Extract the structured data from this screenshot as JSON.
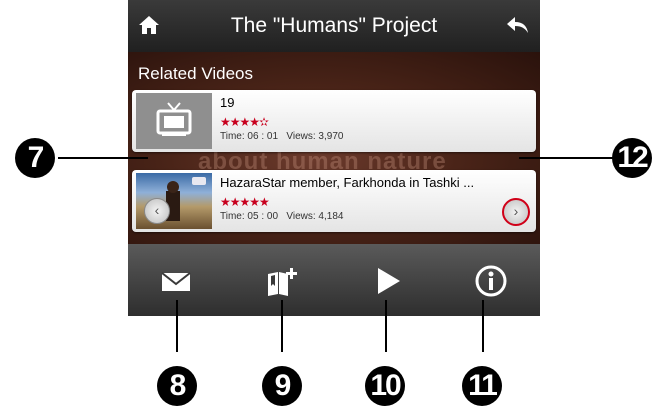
{
  "titlebar": {
    "title": "The \"Humans\" Project"
  },
  "content": {
    "section_title": "Related Videos",
    "overlay_text": "about human nature",
    "videos": [
      {
        "title": "19",
        "stars": "★★★★✫",
        "time_label": "Time:",
        "time": "06 : 01",
        "views_label": "Views:",
        "views": "3,970"
      },
      {
        "title": "HazaraStar member, Farkhonda in Tashki ...",
        "stars": "★★★★★",
        "time_label": "Time:",
        "time": "05 : 00",
        "views_label": "Views:",
        "views": "4,184"
      }
    ]
  },
  "nav": {
    "prev": "‹",
    "next": "›"
  },
  "callouts": [
    "7",
    "8",
    "9",
    "10",
    "11",
    "12"
  ],
  "colors": {
    "accent": "#d00018",
    "stars": "#c8001e"
  },
  "icons": {
    "home": "home-icon",
    "back": "back-arrow-icon",
    "mail": "mail-icon",
    "bookmark": "bookmark-add-icon",
    "play": "play-icon",
    "info": "info-icon"
  }
}
